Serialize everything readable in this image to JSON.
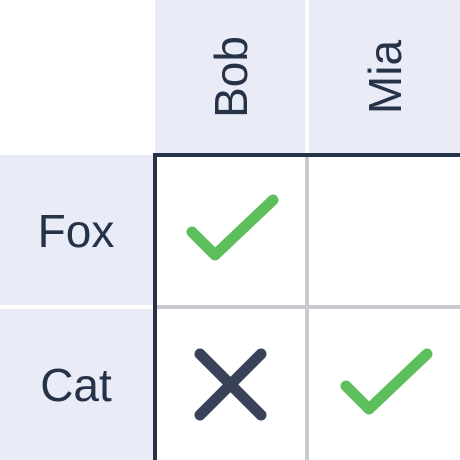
{
  "columns": [
    {
      "label": "Bob"
    },
    {
      "label": "Mia"
    }
  ],
  "rows": [
    {
      "label": "Fox"
    },
    {
      "label": "Cat"
    }
  ],
  "cells": [
    [
      "check",
      "empty"
    ],
    [
      "cross",
      "check"
    ]
  ],
  "colors": {
    "header_bg": "#e9ecf7",
    "text": "#263248",
    "check": "#5cbf5c",
    "cross": "#3a4259",
    "grid_line": "#c9c9d2",
    "border": "#263248"
  }
}
